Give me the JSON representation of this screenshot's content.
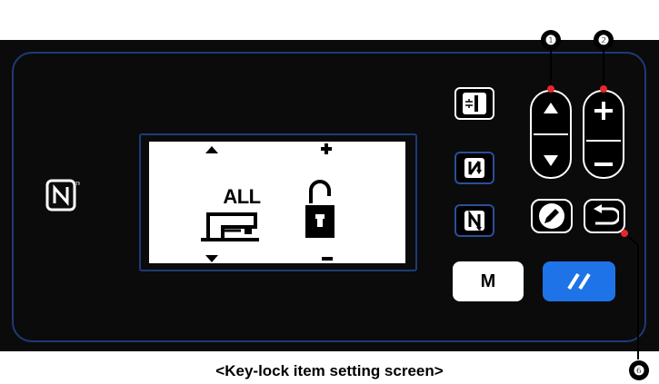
{
  "caption": "<Key-lock item setting screen>",
  "callouts": {
    "up_down": "❶",
    "plus_minus": "❷",
    "return": "❻"
  },
  "lcd": {
    "item_label": "ALL",
    "item_icon": "sewing-machine-icon",
    "state_icon": "unlock-icon"
  },
  "buttons": {
    "m_label": "M",
    "threading_icon": "thread-tension-icon",
    "step_back_icon": "step-back-icon",
    "step_forward_icon": "step-forward-icon",
    "edit_icon": "pencil-icon",
    "return_icon": "return-icon",
    "reset_icon": "reset-icon"
  },
  "colors": {
    "panel": "#0b0b0b",
    "border": "#1e3a78",
    "reset_button": "#1f73e8",
    "callout_dot": "#e8262d"
  }
}
